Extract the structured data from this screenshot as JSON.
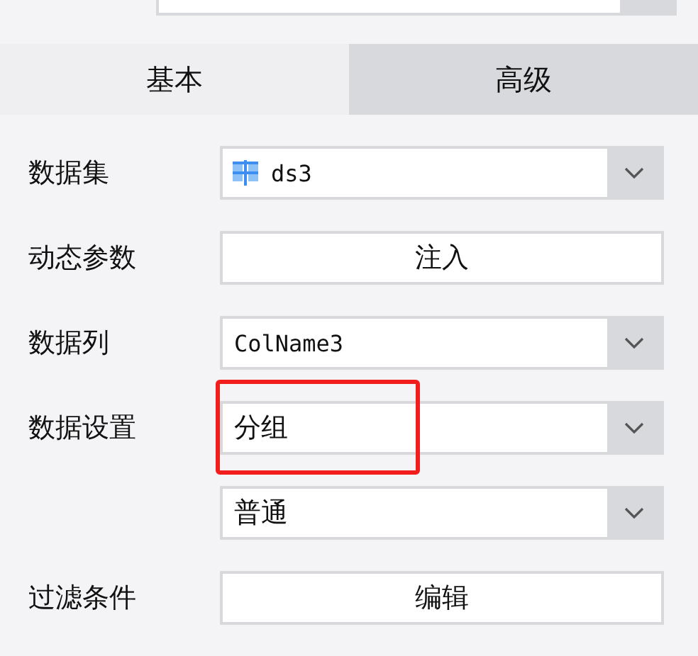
{
  "tabs": [
    {
      "label": "基本",
      "selected": true
    },
    {
      "label": "高级",
      "selected": false
    }
  ],
  "rows": [
    {
      "label": "数据集",
      "kind": "select",
      "value": "ds3",
      "mono": true,
      "icon": true,
      "highlighted": false
    },
    {
      "label": "动态参数",
      "kind": "button",
      "value": "注入",
      "highlighted": false
    },
    {
      "label": "数据列",
      "kind": "select",
      "value": "ColName3",
      "mono": true,
      "icon": false,
      "highlighted": false
    },
    {
      "label": "数据设置",
      "kind": "select",
      "value": "分组",
      "mono": false,
      "icon": false,
      "highlighted": true
    },
    {
      "kind": "select",
      "value": "普通",
      "mono": false,
      "icon": false,
      "highlighted": false
    },
    {
      "label": "过滤条件",
      "kind": "button",
      "value": "编辑",
      "highlighted": false
    }
  ]
}
